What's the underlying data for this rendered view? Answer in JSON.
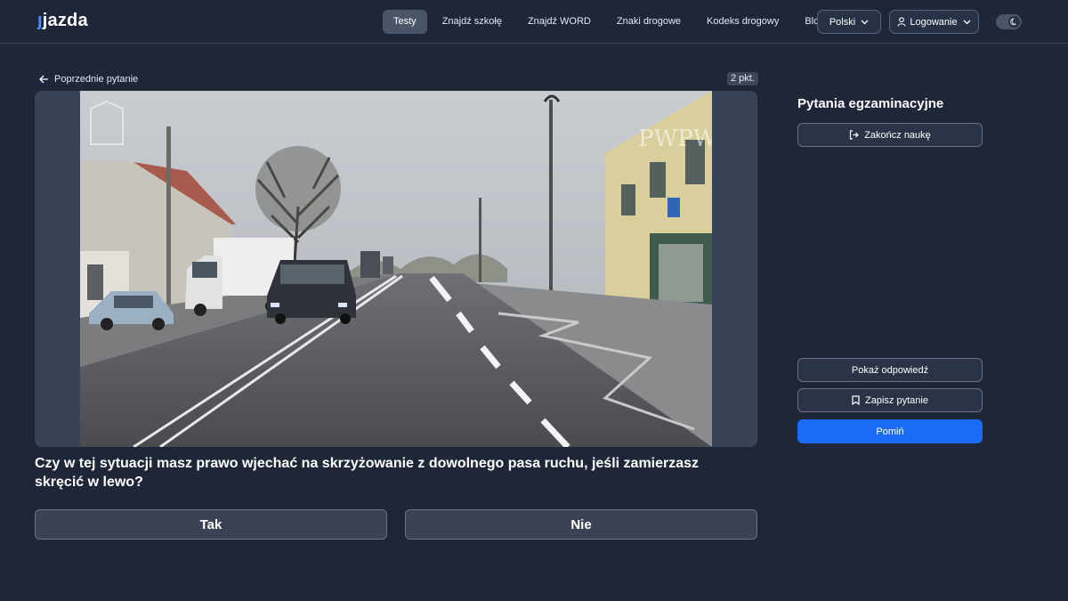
{
  "header": {
    "logo": "jazda",
    "nav": [
      {
        "label": "Testy",
        "active": true
      },
      {
        "label": "Znajdź szkołę",
        "active": false
      },
      {
        "label": "Znajdź WORD",
        "active": false
      },
      {
        "label": "Znaki drogowe",
        "active": false
      },
      {
        "label": "Kodeks drogowy",
        "active": false
      },
      {
        "label": "Blog",
        "active": false
      }
    ],
    "language": "Polski",
    "login": "Logowanie",
    "theme_toggle_icon": "moon-icon"
  },
  "question": {
    "back_label": "Poprzednie pytanie",
    "points": "2 pkt.",
    "text": "Czy w tej sytuacji masz prawo wjechać na skrzyżowanie z dowolnego pasa ruchu, jeśli zamierzasz skręcić w lewo?",
    "answers": [
      "Tak",
      "Nie"
    ],
    "watermark": "PWPW"
  },
  "sidebar": {
    "title": "Pytania egzaminacyjne",
    "end_label": "Zakończ naukę",
    "show_answer_label": "Pokaż odpowiedź",
    "save_label": "Zapisz pytanie",
    "skip_label": "Pomiń"
  },
  "colors": {
    "background": "#1e2638",
    "accent": "#1a6cf5",
    "logo_accent": "#4d8dff"
  }
}
